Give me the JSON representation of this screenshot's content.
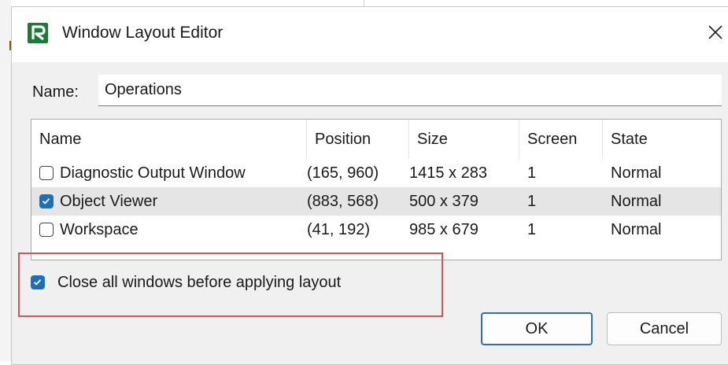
{
  "window": {
    "title": "Window Layout Editor",
    "close_icon": "close-icon",
    "app_icon": "app-logo-icon",
    "accent_color": "#1f6fb8",
    "logo_color": "#1d7a35"
  },
  "name_field": {
    "label": "Name:",
    "value": "Operations"
  },
  "list": {
    "columns": [
      "Name",
      "Position",
      "Size",
      "Screen",
      "State"
    ],
    "rows": [
      {
        "checked": false,
        "name": "Diagnostic Output Window",
        "position": "(165, 960)",
        "size": "1415 x 283",
        "screen": "1",
        "state": "Normal"
      },
      {
        "checked": true,
        "name": "Object Viewer",
        "position": "(883, 568)",
        "size": "500 x 379",
        "screen": "1",
        "state": "Normal",
        "selected": true
      },
      {
        "checked": false,
        "name": "Workspace",
        "position": "(41, 192)",
        "size": "985 x 679",
        "screen": "1",
        "state": "Normal"
      }
    ]
  },
  "options": {
    "close_all_label": "Close all windows before applying layout",
    "close_all_checked": true,
    "highlight_color": "#e05050"
  },
  "buttons": {
    "ok": "OK",
    "cancel": "Cancel"
  }
}
